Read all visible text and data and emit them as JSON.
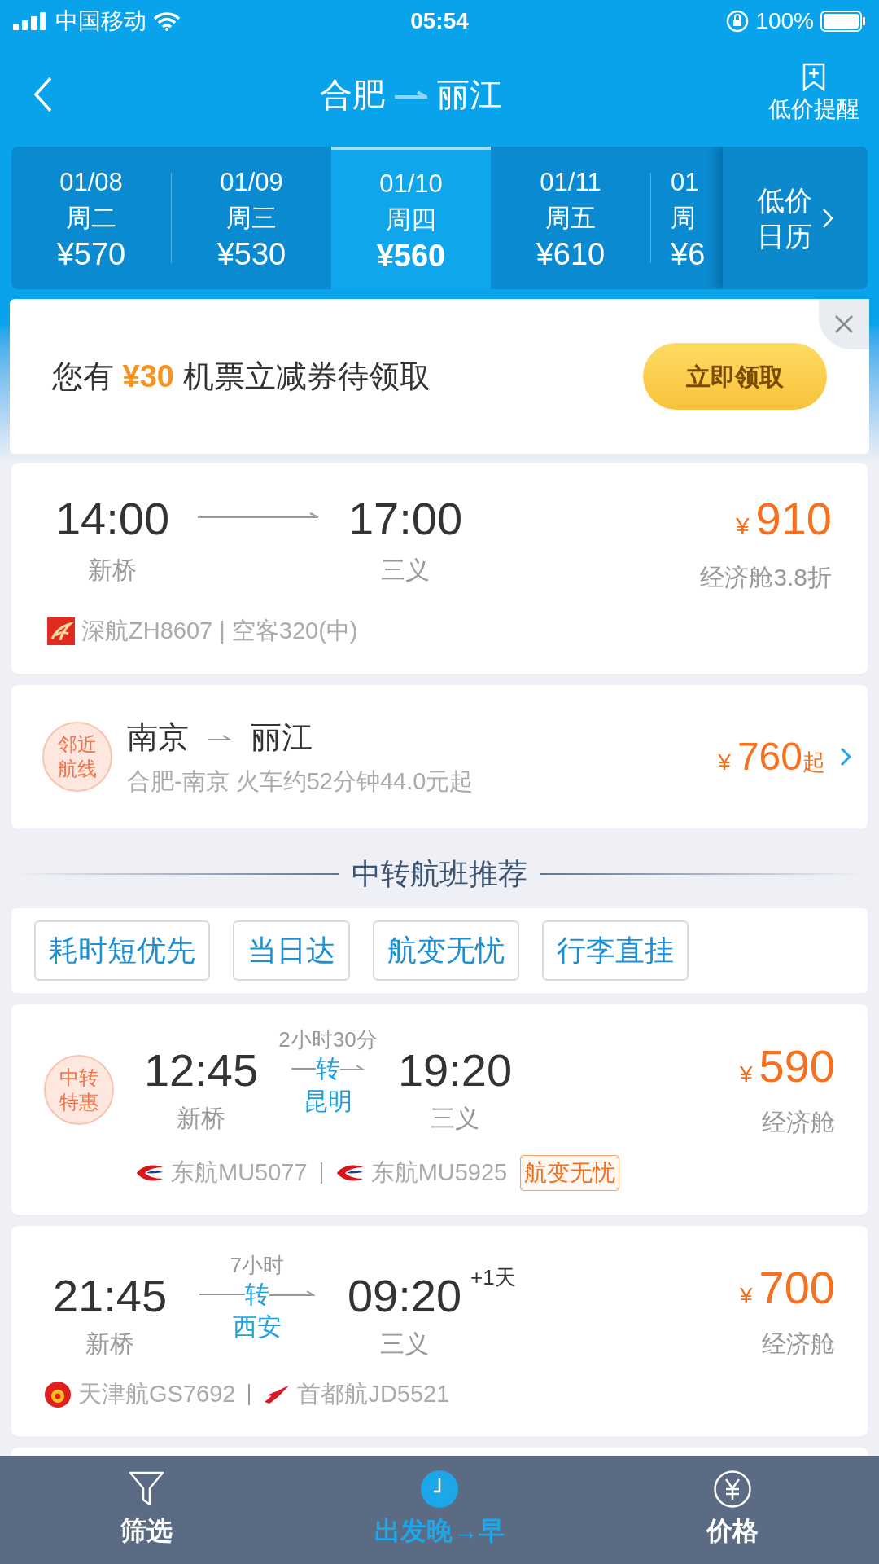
{
  "status_bar": {
    "carrier": "中国移动",
    "time": "05:54",
    "battery": "100%"
  },
  "header": {
    "from": "合肥",
    "to": "丽江",
    "right_label": "低价提醒"
  },
  "dates": [
    {
      "date": "01/08",
      "weekday": "周二",
      "price": "¥570",
      "selected": false
    },
    {
      "date": "01/09",
      "weekday": "周三",
      "price": "¥530",
      "selected": false
    },
    {
      "date": "01/10",
      "weekday": "周四",
      "price": "¥560",
      "selected": true
    },
    {
      "date": "01/11",
      "weekday": "周五",
      "price": "¥610",
      "selected": false
    },
    {
      "date": "01",
      "weekday": "周",
      "price": "¥6",
      "selected": false
    }
  ],
  "calendar_button": {
    "lines": [
      "低价",
      "日历"
    ]
  },
  "coupon": {
    "prefix": "您有",
    "amount": "¥30",
    "suffix": "机票立减券待领取",
    "button": "立即领取"
  },
  "direct_flights": [
    {
      "dep_time": "14:00",
      "arr_time": "17:00",
      "dep_airport": "新桥",
      "arr_airport": "三义",
      "currency": "¥",
      "price": "910",
      "cabin": "经济舱3.8折",
      "kind": "shenzhen",
      "info": "深航ZH8607 | 空客320(中)"
    }
  ],
  "nearby": {
    "badge_lines": [
      "邻近",
      "航线"
    ],
    "from": "南京",
    "to": "丽江",
    "detail": "合肥-南京 火车约52分钟44.0元起",
    "currency": "¥",
    "price": "760",
    "suffix": "起"
  },
  "section_title": "中转航班推荐",
  "filter_tags": [
    "耗时短优先",
    "当日达",
    "航变无忧",
    "行李直挂"
  ],
  "transfer_flights": [
    {
      "badge_lines": [
        "中转",
        "特惠"
      ],
      "dep_time": "12:45",
      "duration": "2小时30分",
      "via_mark": "转",
      "via_city": "昆明",
      "arr_time": "19:20",
      "dep_airport": "新桥",
      "arr_airport": "三义",
      "currency": "¥",
      "price": "590",
      "cabin": "经济舱",
      "legs": [
        {
          "kind": "eastern",
          "text": "东航MU5077"
        },
        {
          "kind": "eastern",
          "text": "东航MU5925"
        }
      ],
      "tag": "航变无忧"
    },
    {
      "dep_time": "21:45",
      "duration": "7小时",
      "via_mark": "转",
      "via_city": "西安",
      "arr_time": "09:20",
      "next_day": "+1天",
      "dep_airport": "新桥",
      "arr_airport": "三义",
      "currency": "¥",
      "price": "700",
      "cabin": "经济舱",
      "legs": [
        {
          "kind": "tianjin",
          "text": "天津航GS7692"
        },
        {
          "kind": "capital",
          "text": "首都航JD5521"
        }
      ]
    }
  ],
  "bottom_nav": [
    {
      "label": "筛选",
      "kind": "filter",
      "selected": false
    },
    {
      "label": "出发晚→早",
      "kind": "clock",
      "selected": true
    },
    {
      "label": "价格",
      "kind": "yen",
      "selected": false
    }
  ]
}
